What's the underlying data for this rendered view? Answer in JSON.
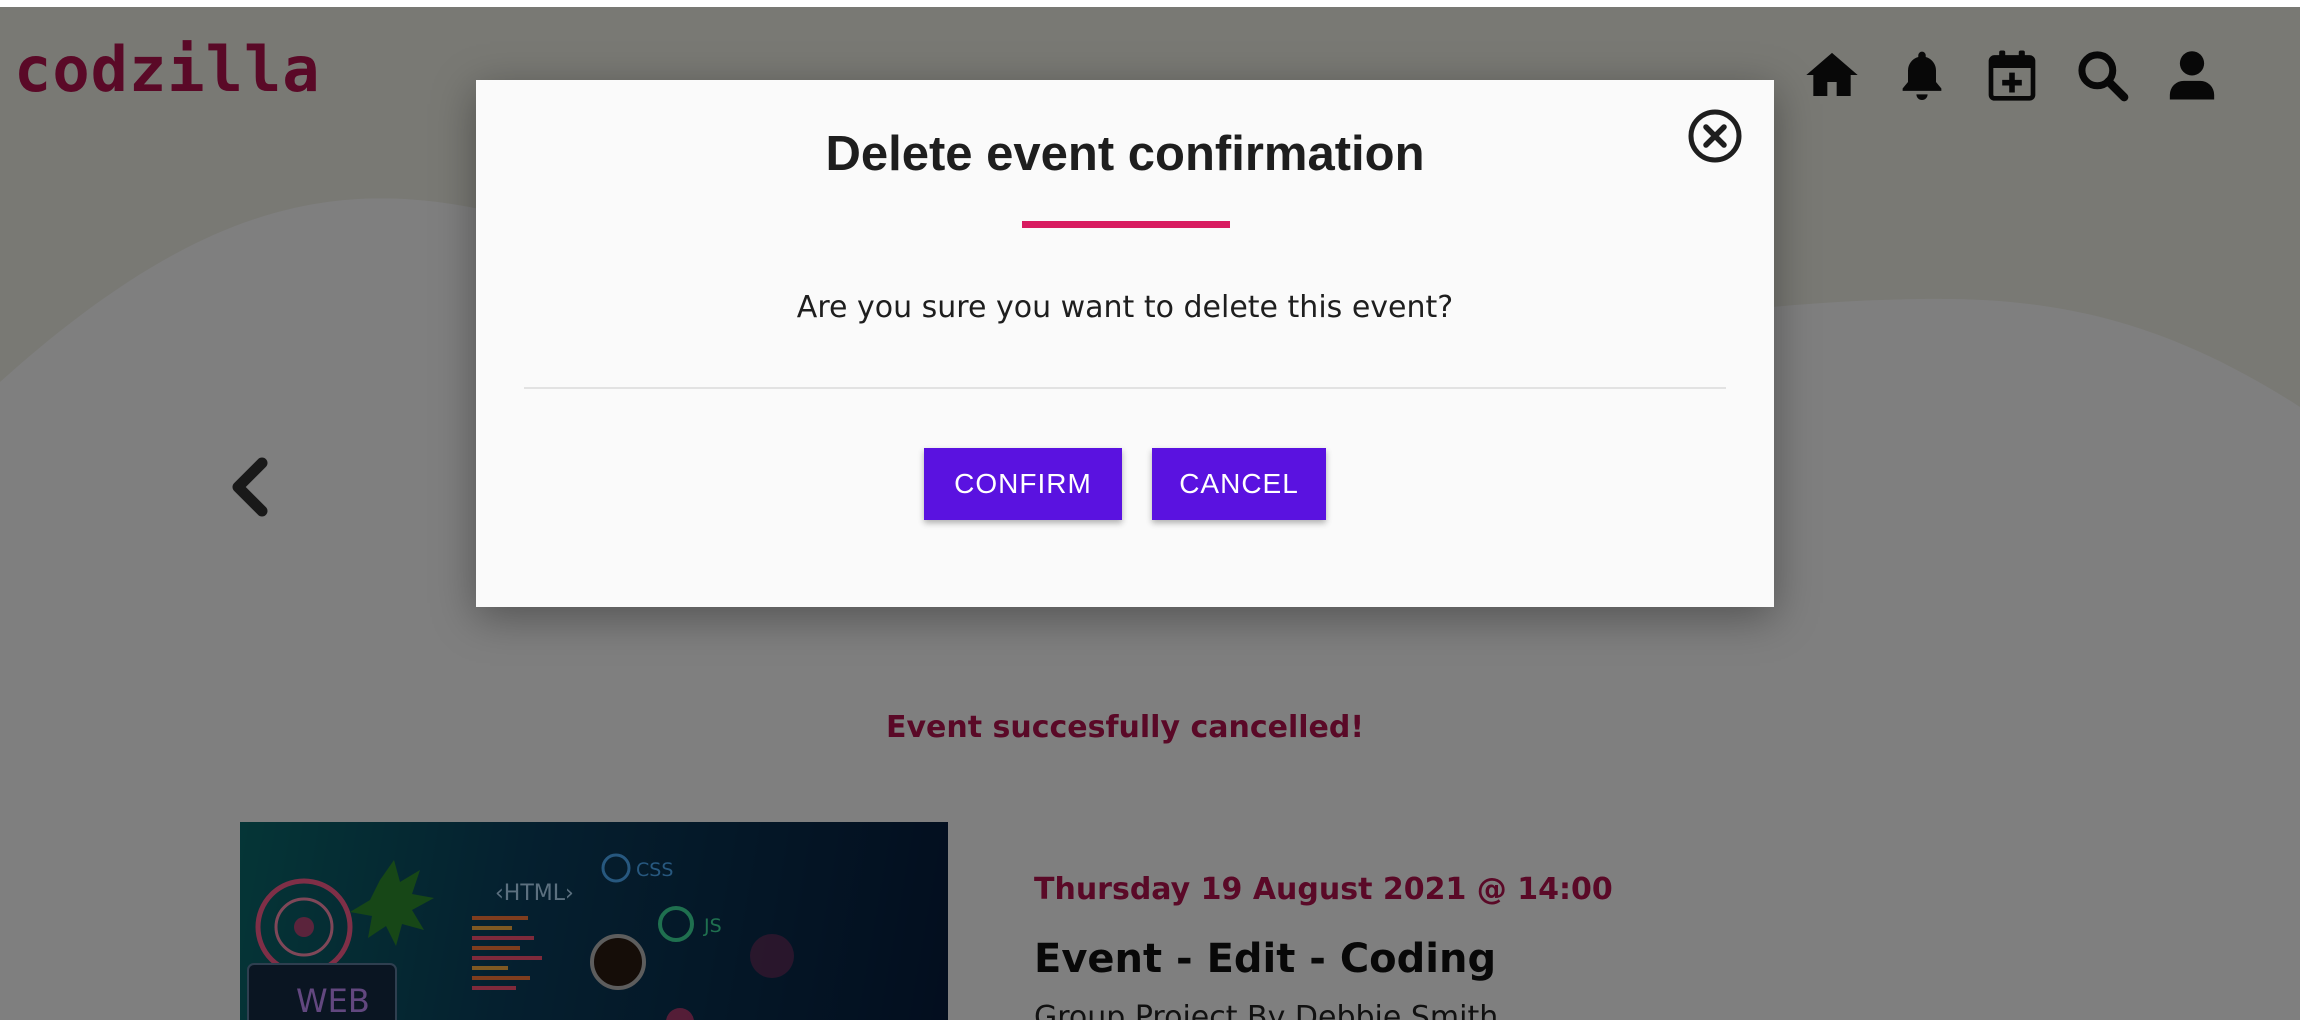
{
  "header": {
    "logo_text": "codzilla",
    "nav_icons": [
      "home-icon",
      "bell-icon",
      "calendar-plus-icon",
      "search-icon",
      "user-icon"
    ]
  },
  "status_message": "Event succesfully cancelled!",
  "event": {
    "date_text": "Thursday 19 August 2021 @ 14:00",
    "title": "Event - Edit - Coding",
    "subtitle": "Group Project By Debbie Smith",
    "image_alt": "web design coding illustration"
  },
  "modal": {
    "title": "Delete event confirmation",
    "message": "Are you sure you want to delete this event?",
    "confirm_label": "CONFIRM",
    "cancel_label": "CANCEL"
  },
  "colors": {
    "brand": "#b4124f",
    "accent_line": "#d81b60",
    "button": "#5a12e0",
    "overlay": "rgba(0,0,0,0.5)"
  }
}
